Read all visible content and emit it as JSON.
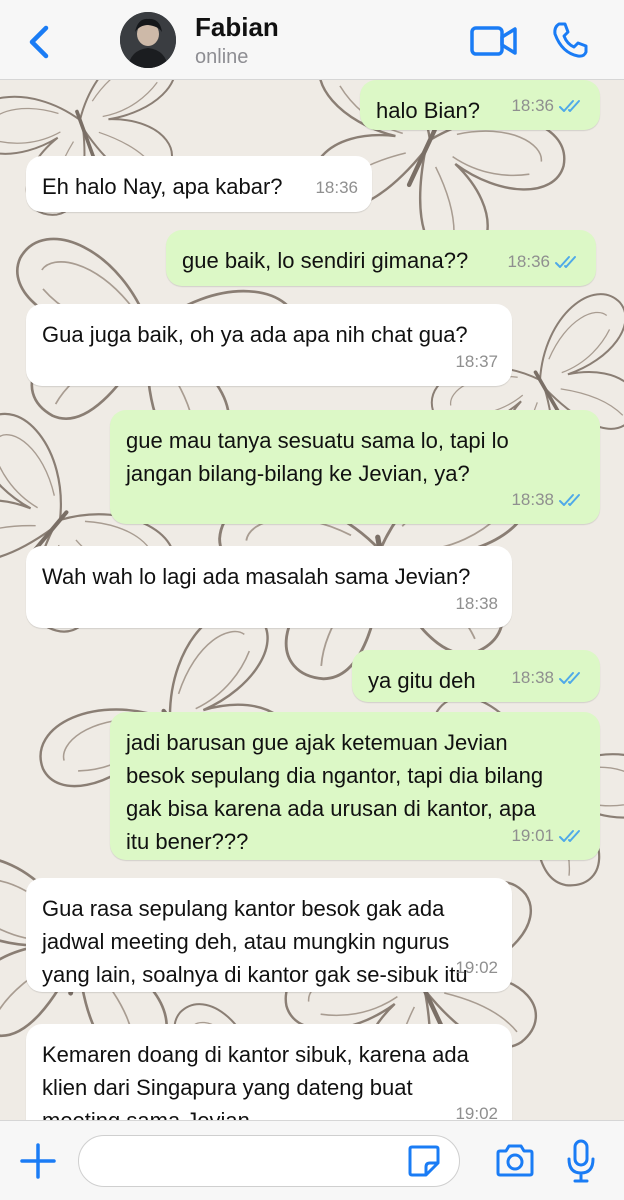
{
  "header": {
    "contact_name": "Fabian",
    "status": "online",
    "icons": {
      "back": "chevron-left-icon",
      "video": "video-camera-icon",
      "call": "phone-icon"
    }
  },
  "colors": {
    "accent": "#1a7cf5",
    "outgoing_bubble": "#dcf8c6",
    "incoming_bubble": "#ffffff",
    "read_ticks": "#4fa9e8"
  },
  "messages": [
    {
      "direction": "out",
      "text": "halo Bian?",
      "time": "18:36",
      "status": "read"
    },
    {
      "direction": "in",
      "text": "Eh halo Nay, apa kabar?",
      "time": "18:36"
    },
    {
      "direction": "out",
      "text": "gue baik, lo sendiri gimana??",
      "time": "18:36",
      "status": "read"
    },
    {
      "direction": "in",
      "text": "Gua juga baik, oh ya ada apa nih chat gua?",
      "time": "18:37"
    },
    {
      "direction": "out",
      "text": "gue mau tanya sesuatu sama lo, tapi lo\njangan bilang-bilang ke Jevian, ya?",
      "time": "18:38",
      "status": "read"
    },
    {
      "direction": "in",
      "text": "Wah wah lo lagi ada masalah sama Jevian?",
      "time": "18:38"
    },
    {
      "direction": "out",
      "text": "ya gitu deh",
      "time": "18:38",
      "status": "read"
    },
    {
      "direction": "out",
      "text": "jadi barusan gue ajak ketemuan Jevian\nbesok sepulang dia ngantor, tapi dia bilang\ngak bisa karena ada urusan di kantor, apa\nitu bener???",
      "time": "19:01",
      "status": "read"
    },
    {
      "direction": "in",
      "text": "Gua rasa sepulang kantor besok gak ada\njadwal meeting deh, atau mungkin ngurus\nyang lain, soalnya di kantor gak se-sibuk itu",
      "time": "19:02"
    },
    {
      "direction": "in",
      "text": "Kemaren doang di kantor sibuk, karena ada\nklien dari Singapura yang dateng buat\nmeeting sama Jevian",
      "time": "19:02"
    }
  ],
  "input_bar": {
    "placeholder": "",
    "icons": {
      "attach": "plus-icon",
      "sticker": "sticker-icon",
      "camera": "camera-icon",
      "mic": "microphone-icon"
    }
  }
}
